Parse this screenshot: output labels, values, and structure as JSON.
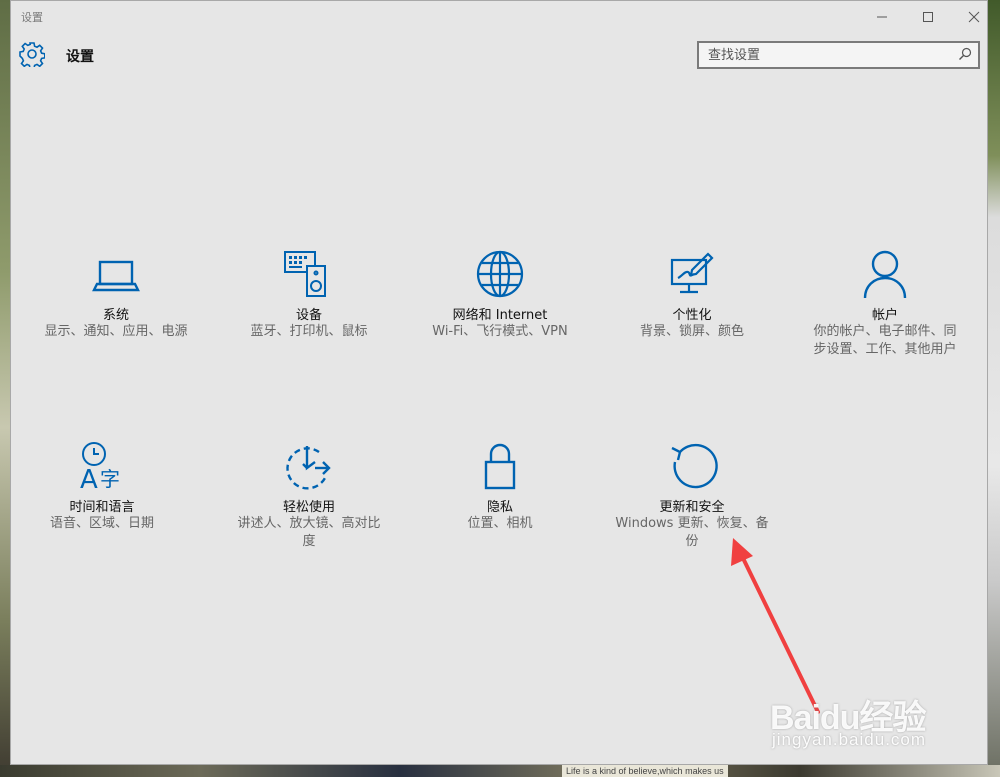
{
  "window": {
    "title": "设置",
    "minimize_glyph": "—",
    "maximize_glyph": "☐",
    "close_glyph": "✕"
  },
  "header": {
    "title": "设置",
    "search_placeholder": "查找设置"
  },
  "accent_color": "#0063b1",
  "tiles": [
    {
      "icon": "laptop-icon",
      "name": "系统",
      "desc": "显示、通知、应用、电源"
    },
    {
      "icon": "devices-icon",
      "name": "设备",
      "desc": "蓝牙、打印机、鼠标"
    },
    {
      "icon": "globe-icon",
      "name": "网络和 Internet",
      "desc": "Wi-Fi、飞行模式、VPN"
    },
    {
      "icon": "personalization-icon",
      "name": "个性化",
      "desc": "背景、锁屏、颜色"
    },
    {
      "icon": "person-icon",
      "name": "帐户",
      "desc": "你的帐户、电子邮件、同步设置、工作、其他用户"
    },
    {
      "icon": "time-language-icon",
      "name": "时间和语言",
      "desc": "语音、区域、日期"
    },
    {
      "icon": "ease-of-access-icon",
      "name": "轻松使用",
      "desc": "讲述人、放大镜、高对比度"
    },
    {
      "icon": "lock-icon",
      "name": "隐私",
      "desc": "位置、相机"
    },
    {
      "icon": "update-icon",
      "name": "更新和安全",
      "desc": "Windows 更新、恢复、备份"
    }
  ],
  "annotation_arrow_color": "#f04040",
  "watermark": {
    "brand": "Baidu经验",
    "url": "jingyan.baidu.com"
  },
  "background_tip": "Life is a kind of believe,which makes us"
}
